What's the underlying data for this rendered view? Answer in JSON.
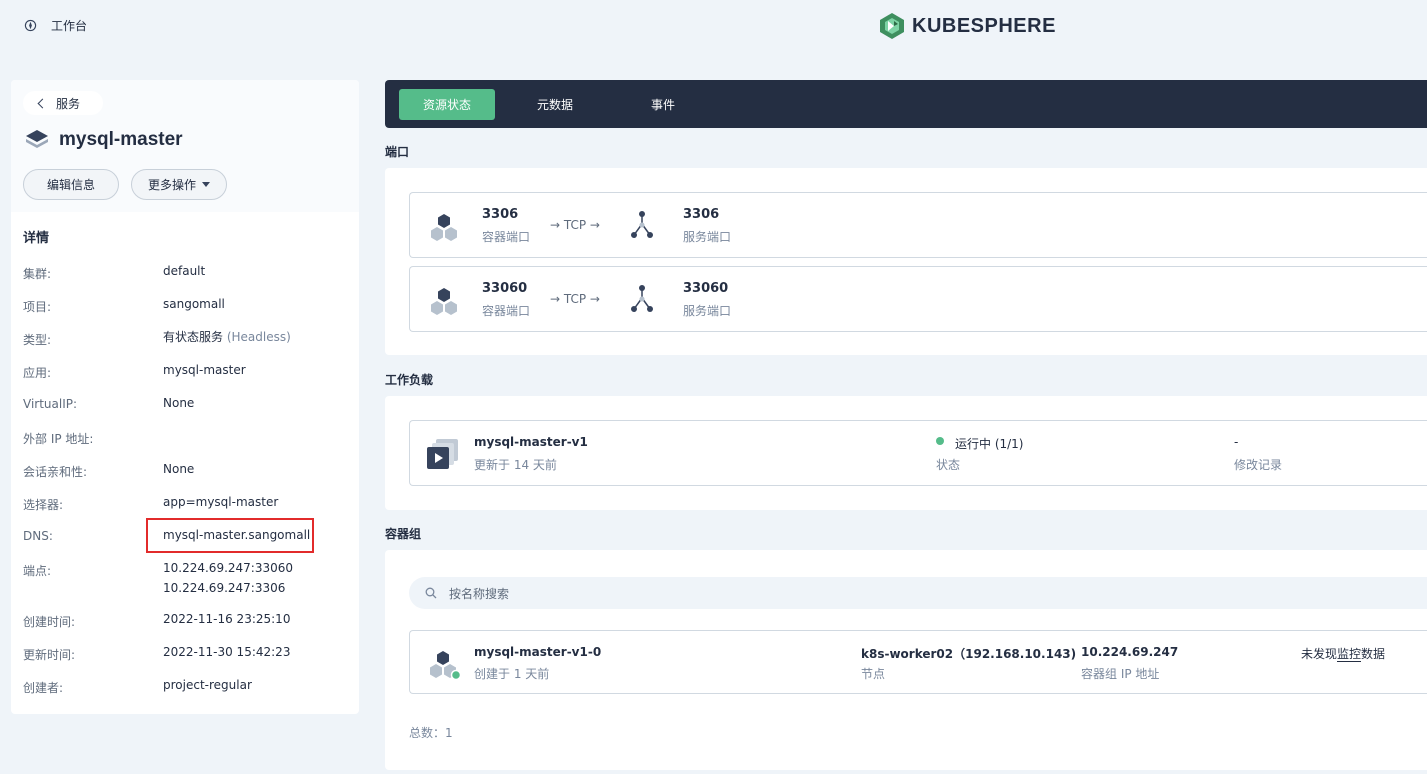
{
  "header": {
    "workbench_label": "工作台",
    "logo_text": "KUBESPHERE"
  },
  "left": {
    "back_label": "服务",
    "service_name": "mysql-master",
    "edit_button": "编辑信息",
    "more_button": "更多操作",
    "details_title": "详情",
    "details": [
      {
        "key": "集群:",
        "value": "default"
      },
      {
        "key": "项目:",
        "value": "sangomall"
      },
      {
        "key": "类型:",
        "value": "有状态服务",
        "extra": "(Headless)"
      },
      {
        "key": "应用:",
        "value": "mysql-master"
      },
      {
        "key": "VirtualIP:",
        "value": "None"
      },
      {
        "key": "外部 IP 地址:",
        "value": ""
      },
      {
        "key": "会话亲和性:",
        "value": "None"
      },
      {
        "key": "选择器:",
        "value": "app=mysql-master"
      },
      {
        "key": "DNS:",
        "value": "mysql-master.sangomall"
      },
      {
        "key": "端点:",
        "value": "10.224.69.247:33060",
        "value2": "10.224.69.247:3306"
      },
      {
        "key": "创建时间:",
        "value": "2022-11-16 23:25:10"
      },
      {
        "key": "更新时间:",
        "value": "2022-11-30 15:42:23"
      },
      {
        "key": "创建者:",
        "value": "project-regular"
      }
    ]
  },
  "tabs": [
    "资源状态",
    "元数据",
    "事件"
  ],
  "ports": {
    "section_label": "端口",
    "items": [
      {
        "container_port": "3306",
        "container_label": "容器端口",
        "protocol": "→ TCP →",
        "service_port": "3306",
        "service_label": "服务端口"
      },
      {
        "container_port": "33060",
        "container_label": "容器端口",
        "protocol": "→ TCP →",
        "service_port": "33060",
        "service_label": "服务端口"
      }
    ]
  },
  "workload": {
    "section_label": "工作负载",
    "name": "mysql-master-v1",
    "updated": "更新于 14 天前",
    "status": "运行中 (1/1)",
    "status_label": "状态",
    "revision": "-",
    "revision_label": "修改记录"
  },
  "pods": {
    "section_label": "容器组",
    "search_placeholder": "按名称搜索",
    "item": {
      "name": "mysql-master-v1-0",
      "created": "创建于 1 天前",
      "node": "k8s-worker02（192.168.10.143)",
      "node_label": "节点",
      "ip": "10.224.69.247",
      "ip_label": "容器组 IP 地址",
      "monitor_prefix": "未发现",
      "monitor_link": "监控",
      "monitor_suffix": "数据"
    },
    "total": "总数：1"
  },
  "colors": {
    "accent": "#55bc8a",
    "dark": "#242e42",
    "highlight_box": "#e22b2b"
  }
}
